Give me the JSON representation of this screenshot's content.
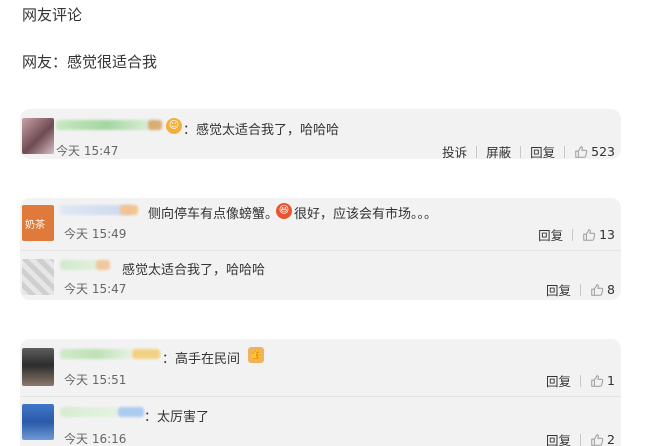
{
  "section_title": "网友评论",
  "intro_comment": "网友：感觉很适合我",
  "comments": [
    {
      "text": "感觉太适合我了，哈哈哈",
      "time": "今天 15:47",
      "report": "投诉",
      "block": "屏蔽",
      "reply": "回复",
      "likes": "523"
    },
    {
      "text_a": "侧向停车有点像螃蟹。",
      "text_b": "很好，应该会有市场。。。",
      "time": "今天 15:49",
      "reply": "回复",
      "likes": "13",
      "avatar_text": "奶茶"
    },
    {
      "text": "感觉太适合我了，哈哈哈",
      "time": "今天 15:47",
      "reply": "回复",
      "likes": "8"
    },
    {
      "text": "：高手在民间",
      "time": "今天 15:51",
      "reply": "回复",
      "likes": "1"
    },
    {
      "text": "：太厉害了",
      "time": "今天 16:16",
      "reply": "回复",
      "likes": "2"
    }
  ]
}
